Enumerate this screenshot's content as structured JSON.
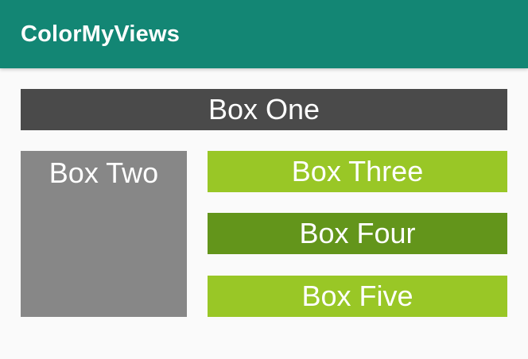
{
  "app_bar": {
    "title": "ColorMyViews",
    "color": "#138674"
  },
  "boxes": {
    "one": {
      "label": "Box One",
      "color": "#4a4a4a"
    },
    "two": {
      "label": "Box Two",
      "color": "#878787"
    },
    "three": {
      "label": "Box Three",
      "color": "#99c726"
    },
    "four": {
      "label": "Box Four",
      "color": "#63951b"
    },
    "five": {
      "label": "Box Five",
      "color": "#99c726"
    }
  },
  "background_color": "#fafafa"
}
